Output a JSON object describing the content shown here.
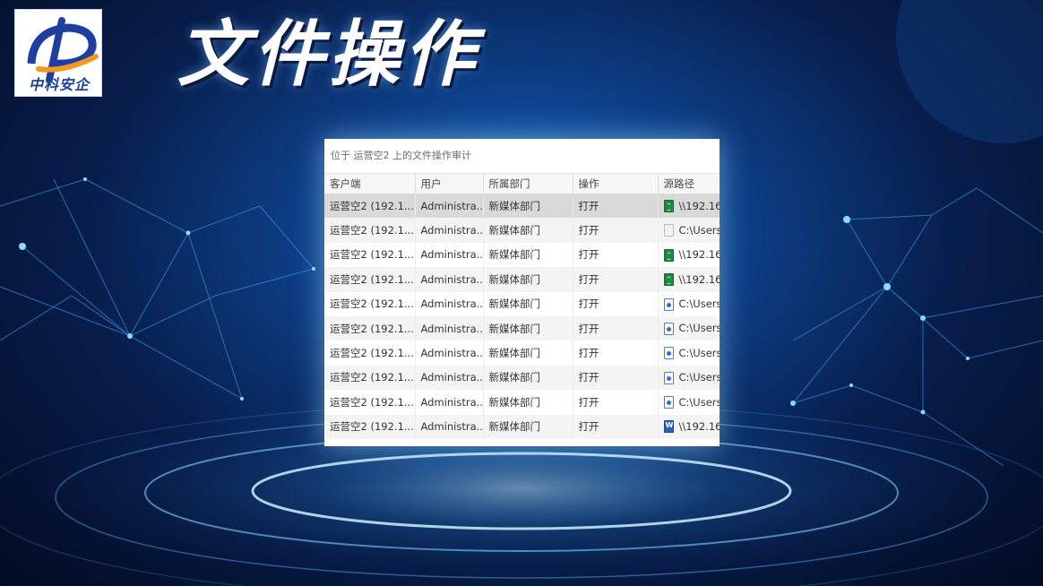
{
  "logo": {
    "text": "中科安企"
  },
  "title": "文件操作",
  "panel": {
    "header": "位于 运营空2 上的文件操作审计",
    "columns": [
      "客户端",
      "用户",
      "所属部门",
      "操作",
      "源路径"
    ],
    "rows": [
      {
        "client": "运营空2 (192.1...",
        "user": "Administra...",
        "dept": "新媒体部门",
        "op": "打开",
        "path": "\\\\192.16",
        "icon": "excel-icon"
      },
      {
        "client": "运营空2 (192.1...",
        "user": "Administra...",
        "dept": "新媒体部门",
        "op": "打开",
        "path": "C:\\Users",
        "icon": "text-file-icon"
      },
      {
        "client": "运营空2 (192.1...",
        "user": "Administra...",
        "dept": "新媒体部门",
        "op": "打开",
        "path": "\\\\192.16",
        "icon": "excel-icon"
      },
      {
        "client": "运营空2 (192.1...",
        "user": "Administra...",
        "dept": "新媒体部门",
        "op": "打开",
        "path": "\\\\192.16",
        "icon": "excel-icon"
      },
      {
        "client": "运营空2 (192.1...",
        "user": "Administra...",
        "dept": "新媒体部门",
        "op": "打开",
        "path": "C:\\Users",
        "icon": "document-icon"
      },
      {
        "client": "运营空2 (192.1...",
        "user": "Administra...",
        "dept": "新媒体部门",
        "op": "打开",
        "path": "C:\\Users",
        "icon": "document-icon"
      },
      {
        "client": "运营空2 (192.1...",
        "user": "Administra...",
        "dept": "新媒体部门",
        "op": "打开",
        "path": "C:\\Users",
        "icon": "document-icon"
      },
      {
        "client": "运营空2 (192.1...",
        "user": "Administra...",
        "dept": "新媒体部门",
        "op": "打开",
        "path": "C:\\Users",
        "icon": "document-icon"
      },
      {
        "client": "运营空2 (192.1...",
        "user": "Administra...",
        "dept": "新媒体部门",
        "op": "打开",
        "path": "C:\\Users",
        "icon": "document-icon"
      },
      {
        "client": "运营空2 (192.1...",
        "user": "Administra...",
        "dept": "新媒体部门",
        "op": "打开",
        "path": "\\\\192.16",
        "icon": "word-icon"
      }
    ]
  },
  "colors": {
    "background": "#071d4a",
    "glow": "#8fd8ff",
    "selected_row": "#d9d9d9"
  }
}
